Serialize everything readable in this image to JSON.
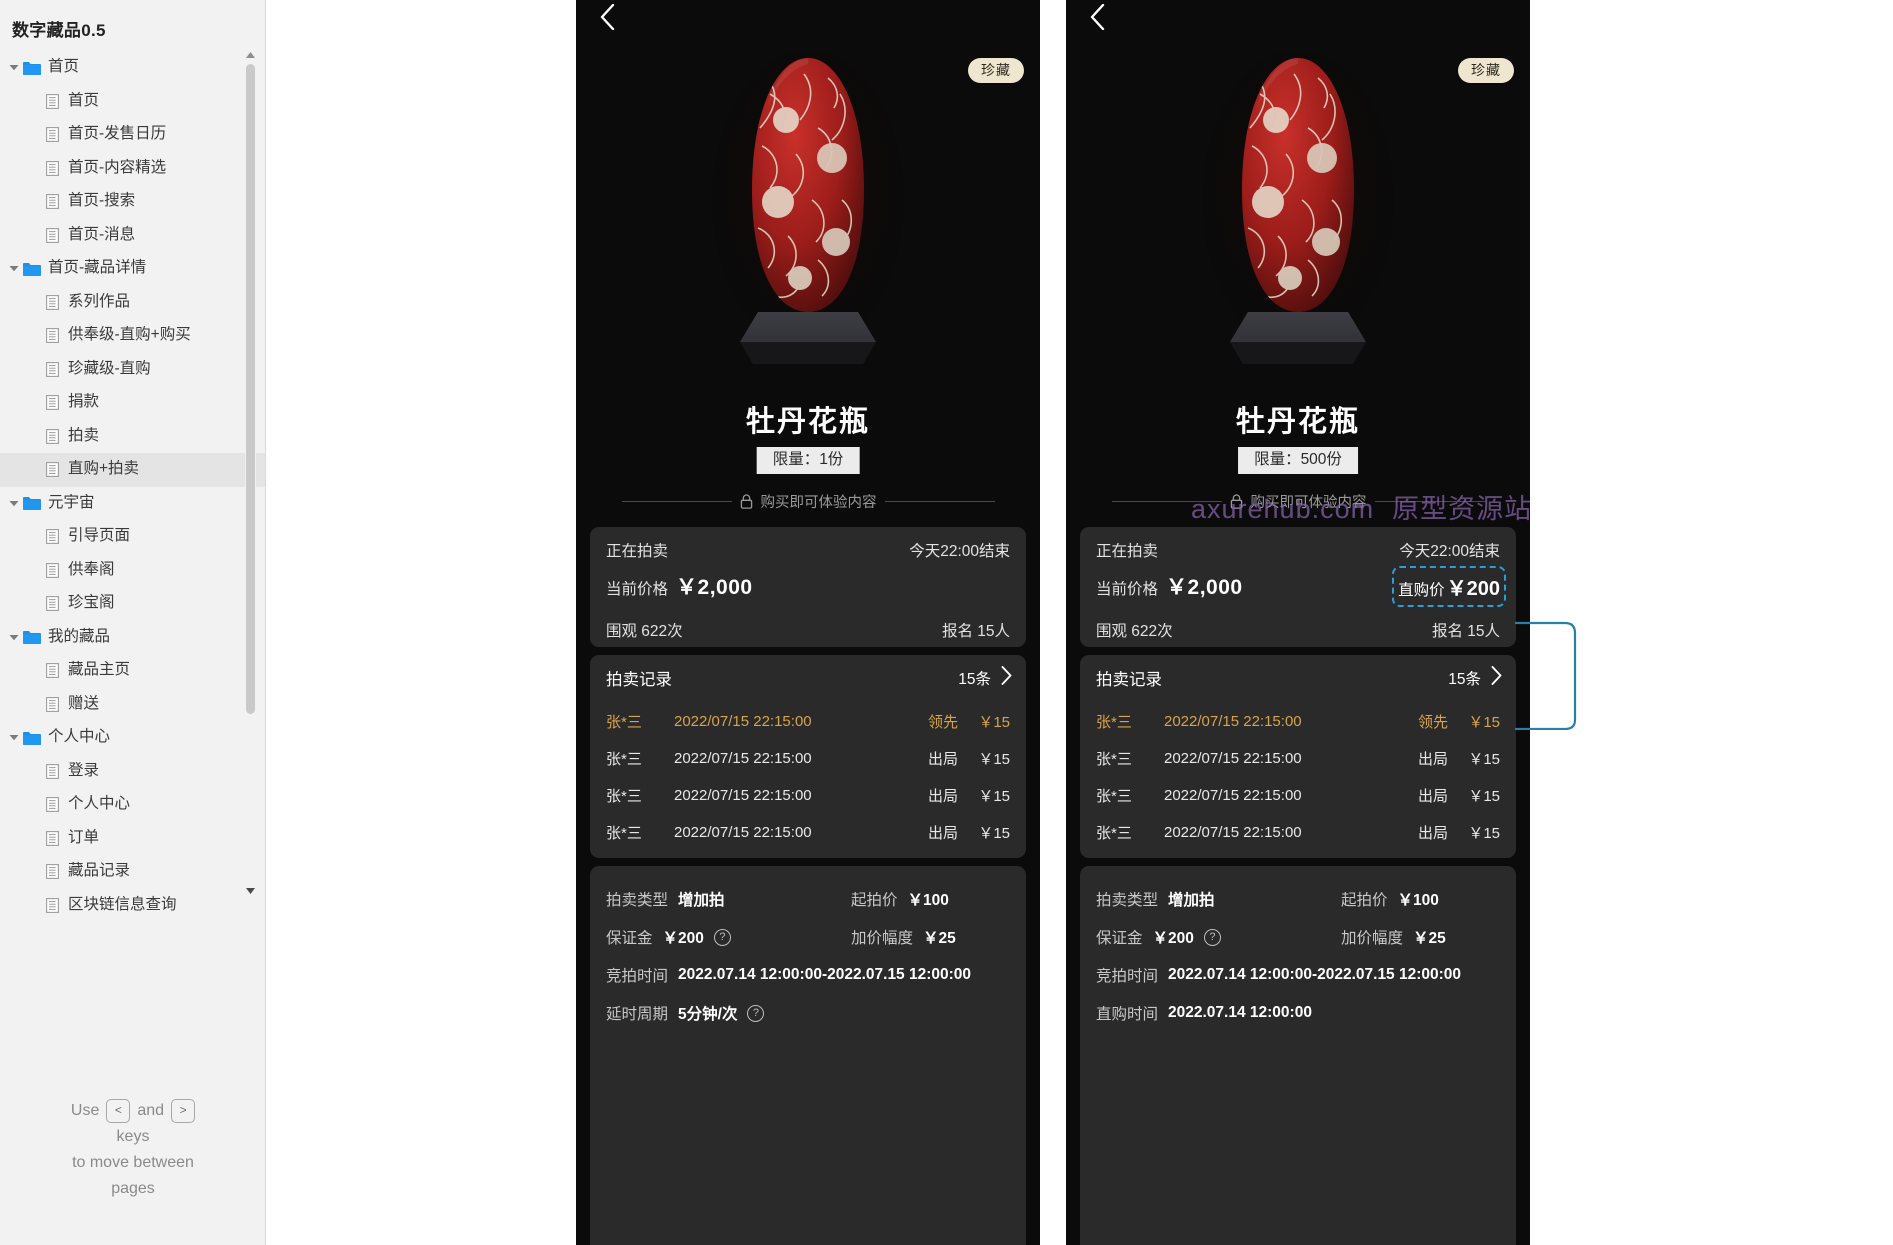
{
  "sidebar": {
    "title": "数字藏品0.5",
    "tree": [
      {
        "level": 1,
        "type": "folder",
        "label": "首页",
        "expanded": true,
        "selected": false
      },
      {
        "level": 2,
        "type": "page",
        "label": "首页",
        "selected": false
      },
      {
        "level": 2,
        "type": "page",
        "label": "首页-发售日历",
        "selected": false
      },
      {
        "level": 2,
        "type": "page",
        "label": "首页-内容精选",
        "selected": false
      },
      {
        "level": 2,
        "type": "page",
        "label": "首页-搜索",
        "selected": false
      },
      {
        "level": 2,
        "type": "page",
        "label": "首页-消息",
        "selected": false
      },
      {
        "level": 1,
        "type": "folder",
        "label": "首页-藏品详情",
        "expanded": true,
        "selected": false
      },
      {
        "level": 2,
        "type": "page",
        "label": "系列作品",
        "selected": false
      },
      {
        "level": 2,
        "type": "page",
        "label": "供奉级-直购+购买",
        "selected": false
      },
      {
        "level": 2,
        "type": "page",
        "label": "珍藏级-直购",
        "selected": false
      },
      {
        "level": 2,
        "type": "page",
        "label": "捐款",
        "selected": false
      },
      {
        "level": 2,
        "type": "page",
        "label": "拍卖",
        "selected": false
      },
      {
        "level": 2,
        "type": "page",
        "label": "直购+拍卖",
        "selected": true
      },
      {
        "level": 1,
        "type": "folder",
        "label": "元宇宙",
        "expanded": true,
        "selected": false
      },
      {
        "level": 2,
        "type": "page",
        "label": "引导页面",
        "selected": false
      },
      {
        "level": 2,
        "type": "page",
        "label": "供奉阁",
        "selected": false
      },
      {
        "level": 2,
        "type": "page",
        "label": "珍宝阁",
        "selected": false
      },
      {
        "level": 1,
        "type": "folder",
        "label": "我的藏品",
        "expanded": true,
        "selected": false
      },
      {
        "level": 2,
        "type": "page",
        "label": "藏品主页",
        "selected": false
      },
      {
        "level": 2,
        "type": "page",
        "label": "赠送",
        "selected": false
      },
      {
        "level": 1,
        "type": "folder",
        "label": "个人中心",
        "expanded": true,
        "selected": false
      },
      {
        "level": 2,
        "type": "page",
        "label": "登录",
        "selected": false
      },
      {
        "level": 2,
        "type": "page",
        "label": "个人中心",
        "selected": false
      },
      {
        "level": 2,
        "type": "page",
        "label": "订单",
        "selected": false
      },
      {
        "level": 2,
        "type": "page",
        "label": "藏品记录",
        "selected": false
      },
      {
        "level": 2,
        "type": "page",
        "label": "区块链信息查询",
        "selected": false
      }
    ],
    "hint": {
      "use": "Use",
      "and": "and",
      "key_prev": "<",
      "key_next": ">",
      "keys": "keys",
      "line3": "to move between",
      "line4": "pages"
    }
  },
  "watermark": {
    "domain": "axurehub.com",
    "cn": "原型资源站",
    "color": "#8c63b0"
  },
  "colors": {
    "accent_gold": "#d8a34a",
    "highlight_blue": "#2a9fd6",
    "card_bg": "#2a2a2a",
    "page_bg": "#0b0b0b",
    "badge_bg": "#efe6cf"
  },
  "screens": [
    {
      "id": "left",
      "back_icon": "chevron-left-icon",
      "collection_badge": "珍藏",
      "product_title": "牡丹花瓶",
      "limit_badge": "限量：1份",
      "experience_note": "购买即可体验内容",
      "lock_icon": "lock-icon",
      "status": {
        "state_label": "正在拍卖",
        "end_label": "今天22:00结束",
        "current_price_label": "当前价格",
        "current_price_value": "￥2,000",
        "views_label": "围观 622次",
        "signups_label": "报名 15人",
        "has_buy_now": false,
        "buy_now_label": "",
        "buy_now_value": ""
      },
      "records": {
        "title": "拍卖记录",
        "count_label": "15条",
        "chevron_icon": "chevron-right-icon",
        "rows": [
          {
            "user": "张*三",
            "time": "2022/07/15 22:15:00",
            "status": "领先",
            "amount": "￥15",
            "leading": true
          },
          {
            "user": "张*三",
            "time": "2022/07/15 22:15:00",
            "status": "出局",
            "amount": "￥15",
            "leading": false
          },
          {
            "user": "张*三",
            "time": "2022/07/15 22:15:00",
            "status": "出局",
            "amount": "￥15",
            "leading": false
          },
          {
            "user": "张*三",
            "time": "2022/07/15 22:15:00",
            "status": "出局",
            "amount": "￥15",
            "leading": false
          }
        ]
      },
      "detail": {
        "type_label": "拍卖类型",
        "type_value": "增加拍",
        "start_price_label": "起拍价",
        "start_price_value": "￥100",
        "deposit_label": "保证金",
        "deposit_value": "￥200",
        "deposit_help_icon": "question-circle-icon",
        "increment_label": "加价幅度",
        "increment_value": "￥25",
        "bid_time_label": "竞拍时间",
        "bid_time_value": "2022.07.14 12:00:00-2022.07.15 12:00:00",
        "last_label": "延时周期",
        "last_value": "5分钟/次",
        "last_help_icon": "question-circle-icon",
        "has_last_help": true
      }
    },
    {
      "id": "right",
      "back_icon": "chevron-left-icon",
      "collection_badge": "珍藏",
      "product_title": "牡丹花瓶",
      "limit_badge": "限量：500份",
      "experience_note": "购买即可体验内容",
      "lock_icon": "lock-icon",
      "status": {
        "state_label": "正在拍卖",
        "end_label": "今天22:00结束",
        "current_price_label": "当前价格",
        "current_price_value": "￥2,000",
        "views_label": "围观 622次",
        "signups_label": "报名 15人",
        "has_buy_now": true,
        "buy_now_label": "直购价",
        "buy_now_value": "￥200"
      },
      "records": {
        "title": "拍卖记录",
        "count_label": "15条",
        "chevron_icon": "chevron-right-icon",
        "rows": [
          {
            "user": "张*三",
            "time": "2022/07/15 22:15:00",
            "status": "领先",
            "amount": "￥15",
            "leading": true
          },
          {
            "user": "张*三",
            "time": "2022/07/15 22:15:00",
            "status": "出局",
            "amount": "￥15",
            "leading": false
          },
          {
            "user": "张*三",
            "time": "2022/07/15 22:15:00",
            "status": "出局",
            "amount": "￥15",
            "leading": false
          },
          {
            "user": "张*三",
            "time": "2022/07/15 22:15:00",
            "status": "出局",
            "amount": "￥15",
            "leading": false
          }
        ]
      },
      "detail": {
        "type_label": "拍卖类型",
        "type_value": "增加拍",
        "start_price_label": "起拍价",
        "start_price_value": "￥100",
        "deposit_label": "保证金",
        "deposit_value": "￥200",
        "deposit_help_icon": "question-circle-icon",
        "increment_label": "加价幅度",
        "increment_value": "￥25",
        "bid_time_label": "竞拍时间",
        "bid_time_value": "2022.07.14 12:00:00-2022.07.15 12:00:00",
        "last_label": "直购时间",
        "last_value": "2022.07.14 12:00:00",
        "last_help_icon": "",
        "has_last_help": false
      }
    }
  ]
}
